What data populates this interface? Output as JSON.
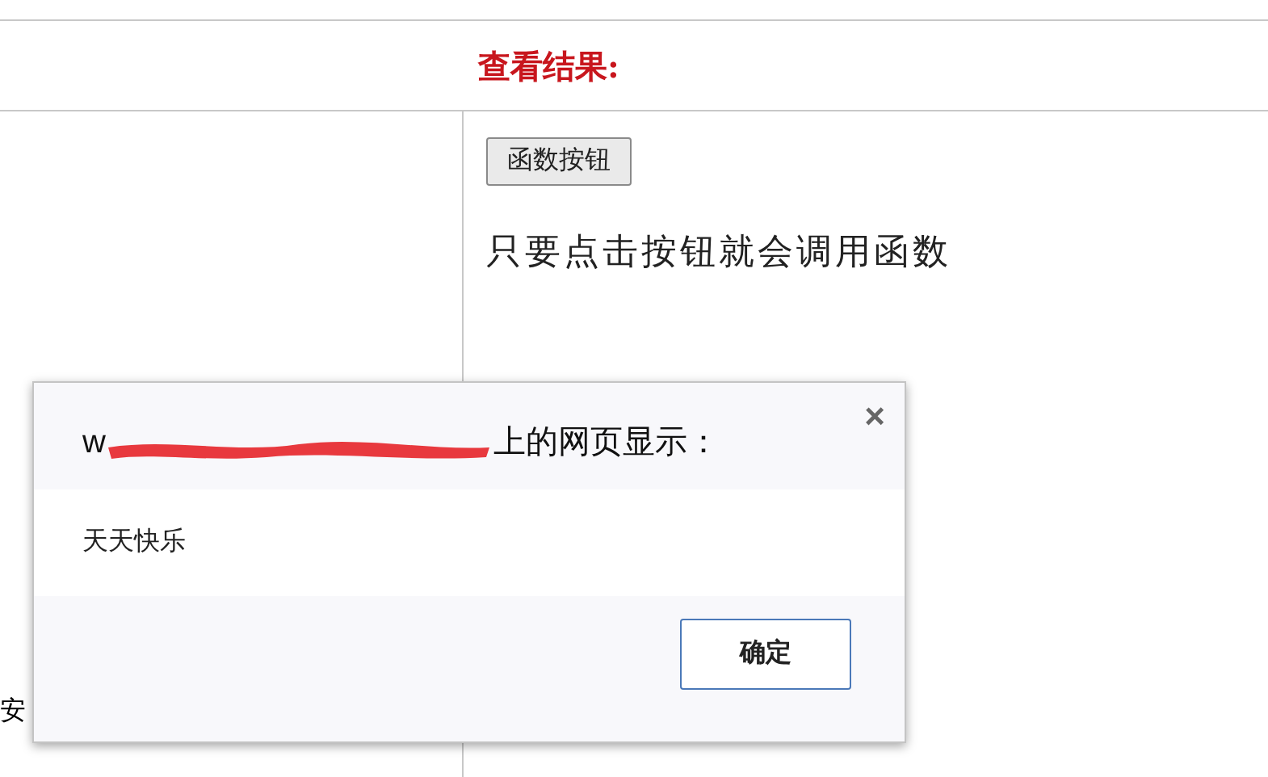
{
  "header": {
    "title": "查看结果:"
  },
  "left_column": {
    "text": "安"
  },
  "right_column": {
    "button": "函数按钮",
    "text": "只要点击按钮就会调用函数"
  },
  "dialog": {
    "title_start": "w",
    "title_end": "上的网页显示：",
    "close": "×",
    "message": "天天快乐",
    "ok_button": "确定"
  }
}
